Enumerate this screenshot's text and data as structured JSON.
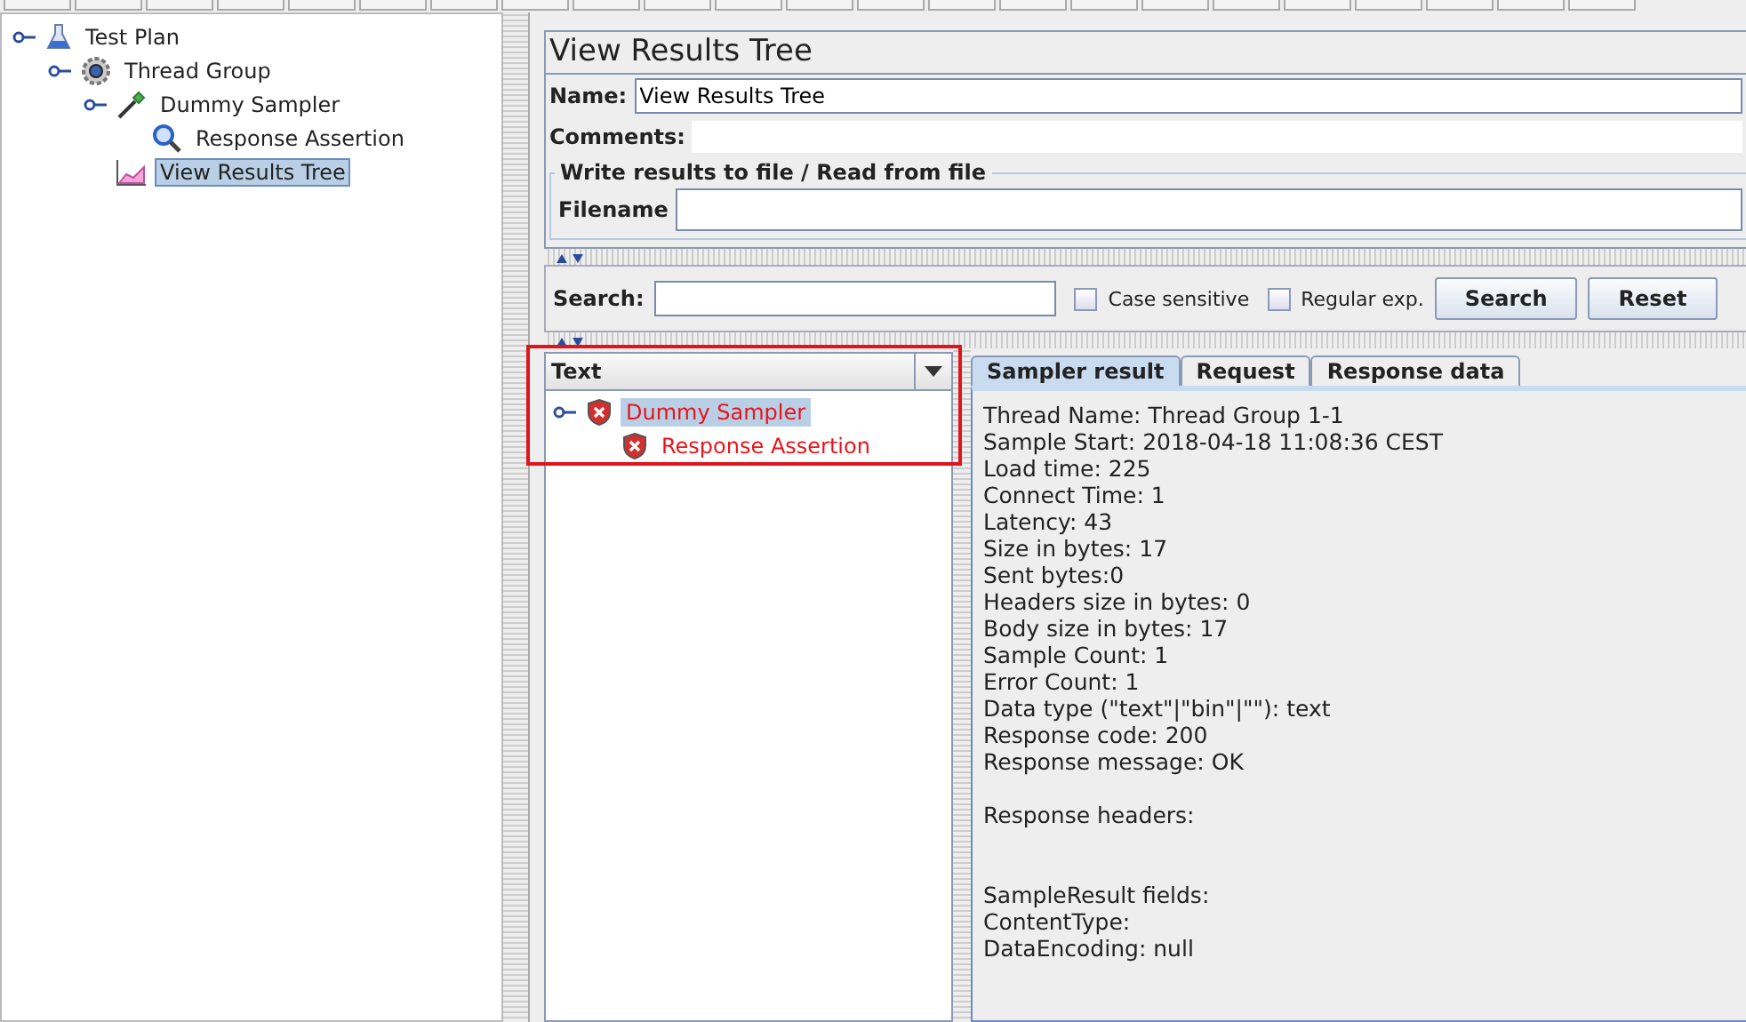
{
  "test_tree": [
    {
      "label": "Test Plan",
      "kind": "flask",
      "expanded": true,
      "selected": false,
      "children": [
        {
          "label": "Thread Group",
          "kind": "gear",
          "expanded": true,
          "selected": false,
          "children": [
            {
              "label": "Dummy Sampler",
              "kind": "dropper",
              "expanded": true,
              "selected": false,
              "children": [
                {
                  "label": "Response Assertion",
                  "kind": "magnifier",
                  "selected": false
                }
              ]
            },
            {
              "label": "View Results Tree",
              "kind": "chart",
              "selected": true
            }
          ]
        }
      ]
    }
  ],
  "panel": {
    "title": "View Results Tree",
    "name_label": "Name:",
    "name_value": "View Results Tree",
    "comments_label": "Comments:"
  },
  "file_group": {
    "legend": "Write results to file / Read from file",
    "filename_label": "Filename"
  },
  "search": {
    "label": "Search:",
    "options": [
      {
        "label": "Case sensitive",
        "checked": false
      },
      {
        "label": "Regular exp.",
        "checked": false
      }
    ],
    "buttons": [
      "Search",
      "Reset"
    ]
  },
  "results_tree": {
    "header": "Text",
    "highlighted": true,
    "items": [
      {
        "label": "Dummy Sampler",
        "failed": true,
        "expanded": true,
        "selected": true,
        "children": [
          {
            "label": "Response Assertion",
            "failed": true,
            "selected": false
          }
        ]
      }
    ]
  },
  "tabs": [
    {
      "label": "Sampler result",
      "selected": true
    },
    {
      "label": "Request",
      "selected": false
    },
    {
      "label": "Response data",
      "selected": false
    }
  ],
  "result_text": "Thread Name: Thread Group 1-1\nSample Start: 2018-04-18 11:08:36 CEST\nLoad time: 225\nConnect Time: 1\nLatency: 43\nSize in bytes: 17\nSent bytes:0\nHeaders size in bytes: 0\nBody size in bytes: 17\nSample Count: 1\nError Count: 1\nData type (\"text\"|\"bin\"|\"\"): text\nResponse code: 200\nResponse message: OK\n\nResponse headers:\n\n\nSampleResult fields:\nContentType:\nDataEncoding: null"
}
